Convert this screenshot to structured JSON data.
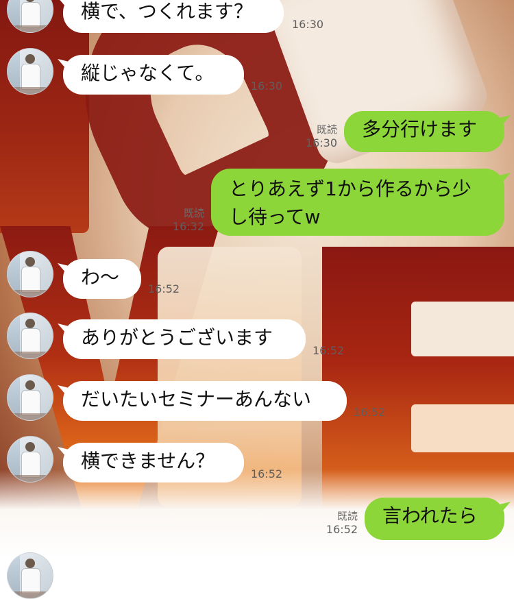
{
  "messages": [
    {
      "id": "m1",
      "side": "in",
      "text": "横で、つくれます？",
      "time": "16:30"
    },
    {
      "id": "m2",
      "side": "in",
      "text": "縦じゃなくて。",
      "time": "16:30"
    },
    {
      "id": "m3",
      "side": "out",
      "text": "多分行けます",
      "read": "既読",
      "time": "16:30"
    },
    {
      "id": "m4",
      "side": "out",
      "text": "とりあえず1から作るから少し待ってw",
      "read": "既読",
      "time": "16:32"
    },
    {
      "id": "m5",
      "side": "in",
      "text": "わ〜",
      "time": "16:52"
    },
    {
      "id": "m6",
      "side": "in",
      "text": "ありがとうございます",
      "time": "16:52"
    },
    {
      "id": "m7",
      "side": "in",
      "text": "だいたいセミナーあんない",
      "time": "16:52"
    },
    {
      "id": "m8",
      "side": "in",
      "text": "横できません？",
      "time": "16:52"
    },
    {
      "id": "m9",
      "side": "out",
      "text": "言われたら",
      "read": "既読",
      "time": "16:52"
    }
  ],
  "colors": {
    "outgoing_bubble": "#8cd63a",
    "incoming_bubble": "#ffffff",
    "meta_text": "#5e5e5e"
  },
  "background": {
    "description_icon": "love-sculpture-wallpaper"
  }
}
